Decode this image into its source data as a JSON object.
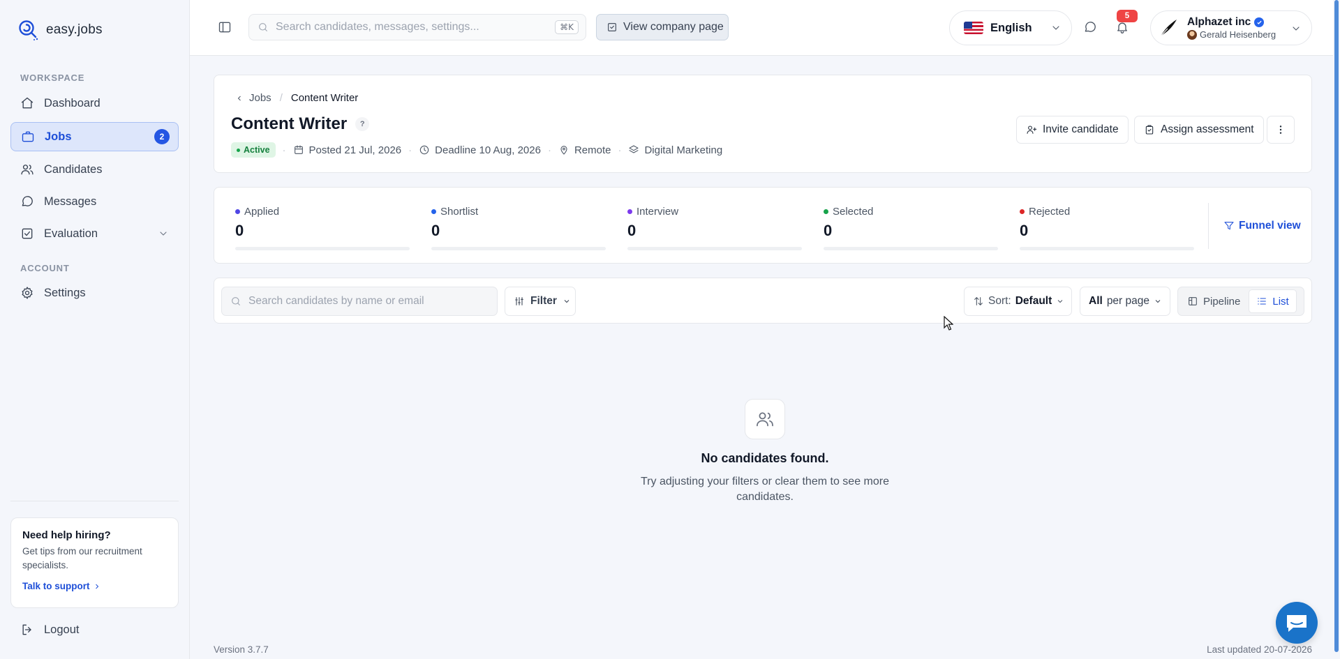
{
  "app": {
    "logo_text": "easy.jobs"
  },
  "sidebar": {
    "workspace_label": "WORKSPACE",
    "account_label": "ACCOUNT",
    "items": [
      {
        "label": "Dashboard"
      },
      {
        "label": "Jobs",
        "badge": "2"
      },
      {
        "label": "Candidates"
      },
      {
        "label": "Messages"
      },
      {
        "label": "Evaluation"
      }
    ],
    "settings_label": "Settings",
    "help": {
      "title": "Need help hiring?",
      "text": "Get tips from our recruitment specialists.",
      "link": "Talk to support"
    },
    "logout_label": "Logout"
  },
  "topbar": {
    "search_placeholder": "Search candidates, messages, settings...",
    "shortcut": "⌘K",
    "view_company_label": "View company page",
    "language": "English",
    "notifications_count": "5",
    "company_name": "Alphazet inc",
    "user_name": "Gerald Heisenberg"
  },
  "job": {
    "breadcrumb_parent": "Jobs",
    "breadcrumb_current": "Content Writer",
    "title": "Content Writer",
    "help_mark": "?",
    "status": "Active",
    "posted": "Posted 21 Jul, 2026",
    "deadline": "Deadline 10 Aug, 2026",
    "location": "Remote",
    "category": "Digital Marketing",
    "invite_label": "Invite candidate",
    "assess_label": "Assign assessment"
  },
  "pipeline_stats": [
    {
      "label": "Applied",
      "value": "0",
      "color": "#4f46e5"
    },
    {
      "label": "Shortlist",
      "value": "0",
      "color": "#2563eb"
    },
    {
      "label": "Interview",
      "value": "0",
      "color": "#7c3aed"
    },
    {
      "label": "Selected",
      "value": "0",
      "color": "#16a34a"
    },
    {
      "label": "Rejected",
      "value": "0",
      "color": "#dc2626"
    }
  ],
  "funnel_label": "Funnel view",
  "toolbar": {
    "search_placeholder": "Search candidates by name or email",
    "filter_label": "Filter",
    "sort_prefix": "Sort:",
    "sort_value": "Default",
    "perpage_value": "All",
    "perpage_suffix": "per page",
    "view_pipeline": "Pipeline",
    "view_list": "List"
  },
  "empty_state": {
    "title": "No candidates found.",
    "text": "Try adjusting your filters or clear them to see more candidates."
  },
  "footer": {
    "version": "Version 3.7.7",
    "updated": "Last updated 20-07-2026"
  },
  "colors": {
    "accent": "#1e4fd8",
    "active_bg": "#dde6fb",
    "badge_red": "#ef4444",
    "status_green": "#15803d"
  }
}
